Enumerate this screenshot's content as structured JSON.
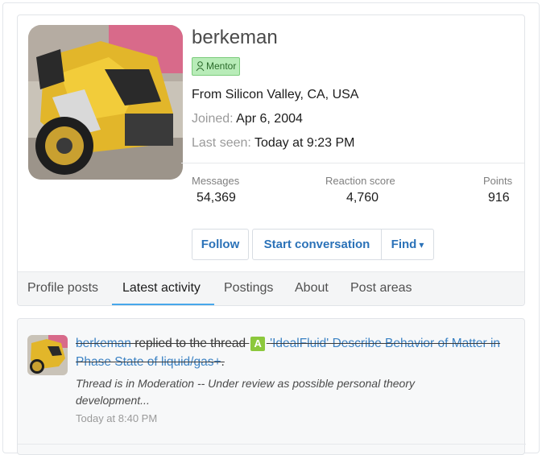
{
  "profile": {
    "username": "berkeman",
    "badge_label": "Mentor",
    "location": "From Silicon Valley, CA, USA",
    "joined_label": "Joined:",
    "joined_value": "Apr 6, 2004",
    "last_seen_label": "Last seen:",
    "last_seen_value": "Today at 9:23 PM"
  },
  "stats": [
    {
      "label": "Messages",
      "value": "54,369"
    },
    {
      "label": "Reaction score",
      "value": "4,760"
    },
    {
      "label": "Points",
      "value": "916"
    }
  ],
  "buttons": {
    "follow": "Follow",
    "start_conversation": "Start conversation",
    "find": "Find",
    "find_caret": "▾"
  },
  "tabs": [
    {
      "label": "Profile posts"
    },
    {
      "label": "Latest activity"
    },
    {
      "label": "Postings"
    },
    {
      "label": "About"
    },
    {
      "label": "Post areas"
    }
  ],
  "activity": {
    "user": "berkeman",
    "action": " replied to the thread ",
    "prefix": "A",
    "thread_title": "'IdealFluid' Describe Behavior of Matter in Phase State of liquid/gas+",
    "trailing": ".",
    "snippet": "Thread is in Moderation -- Under review as possible personal theory development...",
    "timestamp": "Today at 8:40 PM"
  },
  "colors": {
    "link": "#2b72b8",
    "badge_bg": "#b8ecb8",
    "tab_accent": "#47a7eb",
    "prefix_bg": "#8cc83c"
  }
}
